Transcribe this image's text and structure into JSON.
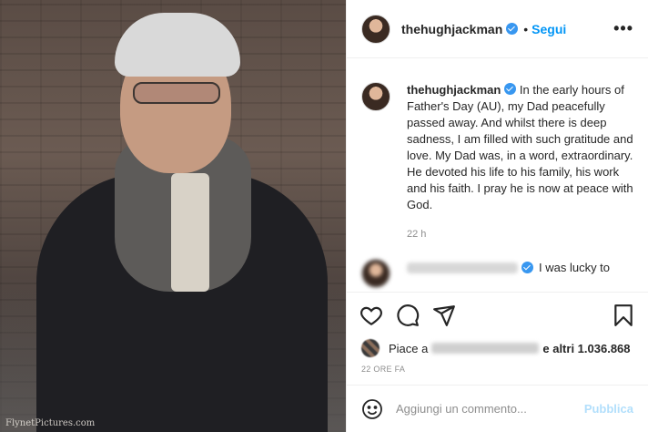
{
  "photo": {
    "watermark": "FlynetPictures.com"
  },
  "header": {
    "username": "thehughjackman",
    "separator": "•",
    "follow_label": "Segui",
    "more_label": "•••"
  },
  "caption": {
    "username": "thehughjackman",
    "text": "In the early hours of Father's Day (AU), my Dad peacefully passed away. And whilst there is deep sadness, I am filled with such gratitude and love. My Dad was, in a word, extraordinary. He devoted his life to his family, his work and his faith. I pray he is now at peace with God.",
    "time": "22 h"
  },
  "comment2": {
    "text": "I was lucky to"
  },
  "actions": {
    "icons": [
      "heart-icon",
      "comment-icon",
      "share-icon",
      "bookmark-icon"
    ]
  },
  "likes": {
    "prefix": "Piace a",
    "suffix": "e altri 1.036.868"
  },
  "post_time": "22 ORE FA",
  "add_comment": {
    "placeholder": "Aggiungi un commento...",
    "publish_label": "Pubblica"
  },
  "colors": {
    "link_blue": "#0095f6",
    "verified_blue": "#3897f0",
    "publish_disabled": "#b2dffc"
  }
}
